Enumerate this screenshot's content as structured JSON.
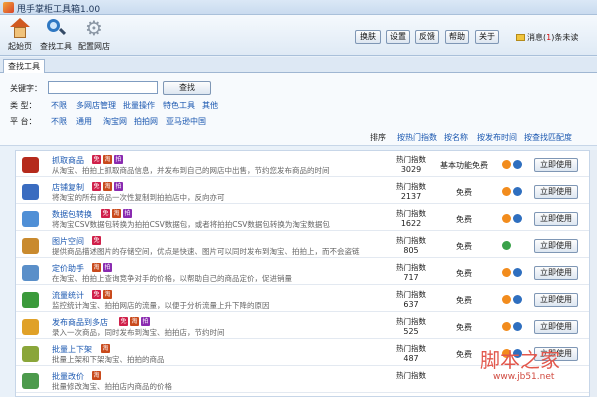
{
  "window": {
    "title": "甩手掌柜工具箱1.00"
  },
  "toolbar": {
    "items": [
      {
        "label": "起始页",
        "icon": "home-icon"
      },
      {
        "label": "查找工具",
        "icon": "magnifier-icon"
      },
      {
        "label": "配置网店",
        "icon": "gear-icon"
      }
    ],
    "buttons": [
      "换肤",
      "设置",
      "反馈",
      "帮助",
      "关于"
    ],
    "message": {
      "prefix": "消息(",
      "count": "1",
      "suffix": ")条未读"
    }
  },
  "tabs": [
    "查找工具"
  ],
  "filter": {
    "keyword_label": "关键字：",
    "keyword_value": "",
    "search_label": "查找",
    "type_label": "类  型：",
    "types": [
      "不限",
      "多网店管理",
      "批量操作",
      "特色工具",
      "其他"
    ],
    "platform_label": "平  台：",
    "platforms": [
      "不限",
      "通用",
      "淘宝网",
      "拍拍网",
      "亚马逊中国"
    ],
    "sort_label": "排序",
    "sorts": [
      "按热门指数",
      "按名称",
      "按发布时间",
      "按查找匹配度"
    ]
  },
  "list": {
    "hot_label": "热门指数",
    "use_label": "立即使用",
    "rows": [
      {
        "name": "抓取商品",
        "badges": [
          "free",
          "tb",
          "pp"
        ],
        "desc": "从淘宝、拍拍上抓取商品信息，并发布到自己的网店中出售，节约您发布商品的时间",
        "hot": "3029",
        "price": "基本功能免费",
        "minis": [
          "o",
          "b"
        ],
        "color": "#b52a1c"
      },
      {
        "name": "店铺复制",
        "badges": [
          "free",
          "tb",
          "pp"
        ],
        "desc": "将淘宝的所有商品一次性复制到拍拍店中，反向亦可",
        "hot": "2137",
        "price": "免费",
        "minis": [
          "o",
          "b"
        ],
        "color": "#3a6cc0"
      },
      {
        "name": "数据包转换",
        "badges": [
          "free",
          "tb",
          "pp"
        ],
        "desc": "将淘宝CSV数据包转换为拍拍CSV数据包，或者将拍拍CSV数据包转换为淘宝数据包",
        "hot": "1622",
        "price": "免费",
        "minis": [
          "o",
          "b"
        ],
        "color": "#4f8fd6"
      },
      {
        "name": "图片空间",
        "badges": [
          "free"
        ],
        "desc": "提供商品描述图片的存储空间，优点是快速、图片可以同时发布到淘宝、拍拍上，而不会盗链",
        "hot": "805",
        "price": "免费",
        "minis": [
          "g"
        ],
        "color": "#c98a2e"
      },
      {
        "name": "定价助手",
        "badges": [
          "tb",
          "pp"
        ],
        "desc": "在淘宝、拍拍上查询竞争对手的价格，以帮助自己的商品定价，促进销量",
        "hot": "717",
        "price": "免费",
        "minis": [
          "o",
          "b"
        ],
        "color": "#5a8fc9"
      },
      {
        "name": "流量统计",
        "badges": [
          "free",
          "tb"
        ],
        "desc": "监控统计淘宝、拍拍网店的流量，以便于分析流量上升下降的原因",
        "hot": "637",
        "price": "免费",
        "minis": [
          "o",
          "b"
        ],
        "color": "#3b9a3b"
      },
      {
        "name": "发布商品到多店",
        "badges": [
          "free",
          "tb",
          "pp"
        ],
        "desc": "录入一次商品，同时发布到淘宝、拍拍店，节约时间",
        "hot": "525",
        "price": "免费",
        "minis": [
          "o",
          "b"
        ],
        "color": "#e0a128"
      },
      {
        "name": "批量上下架",
        "badges": [
          "tb"
        ],
        "desc": "批量上架和下架淘宝、拍拍的商品",
        "hot": "487",
        "price": "免费",
        "minis": [
          "o",
          "b"
        ],
        "color": "#8aa63a"
      },
      {
        "name": "批量改价",
        "badges": [
          "tb"
        ],
        "desc": "批量修改淘宝、拍拍店内商品的价格",
        "hot": "",
        "price": "",
        "minis": [],
        "color": "#4c9a4c"
      }
    ]
  },
  "watermark": {
    "title": "脚本之家",
    "url": "www.jb51.net"
  }
}
